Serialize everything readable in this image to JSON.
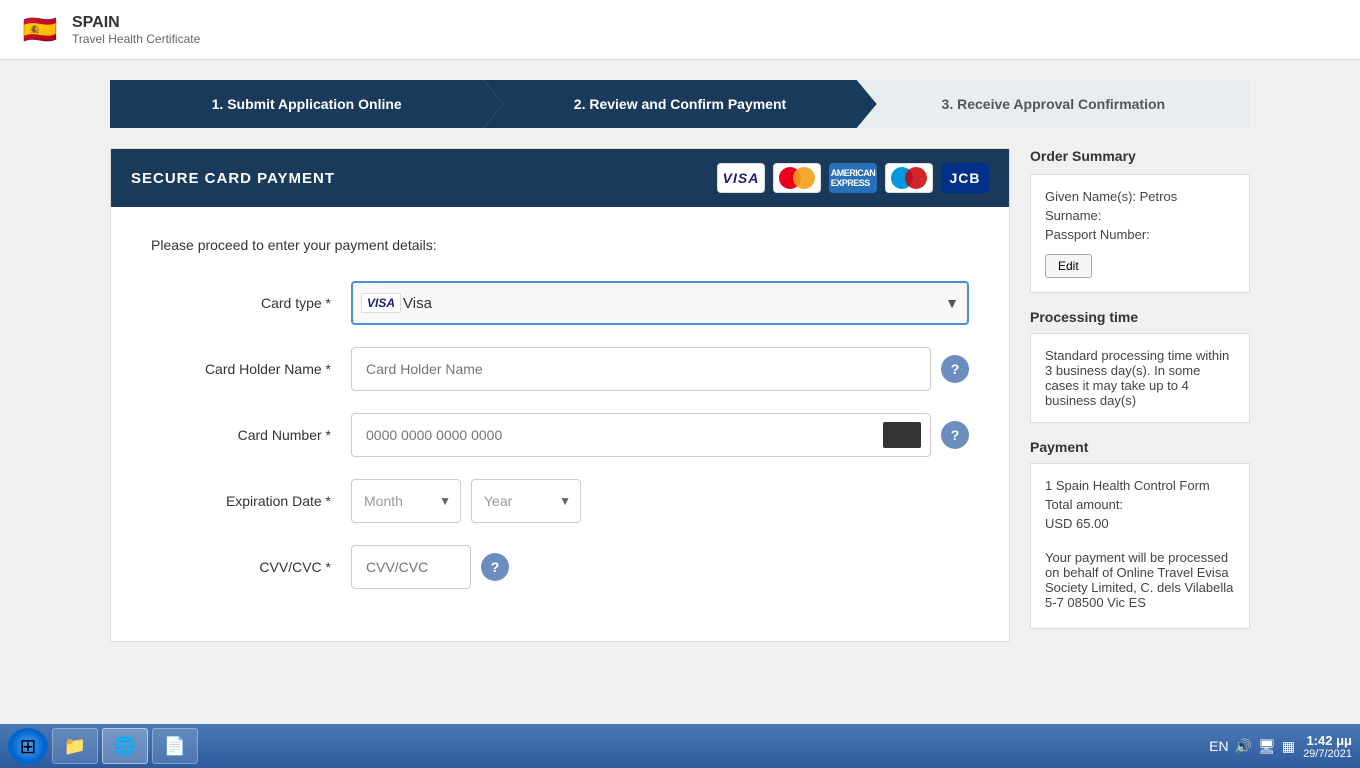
{
  "header": {
    "country": "SPAIN",
    "subtitle": "Travel Health Certificate",
    "flag_emoji": "🇪🇸"
  },
  "steps": {
    "step1": {
      "label": "1. Submit Application Online",
      "active": false
    },
    "step2": {
      "label": "2. Review and Confirm Payment",
      "active": true
    },
    "step3": {
      "label": "3. Receive Approval Confirmation",
      "active": false
    }
  },
  "payment_section": {
    "title": "SECURE CARD PAYMENT",
    "proceed_text": "Please proceed to enter your payment details:",
    "form": {
      "card_type_label": "Card type *",
      "card_type_value": "Visa",
      "card_holder_label": "Card Holder Name *",
      "card_holder_placeholder": "Card Holder Name",
      "card_number_label": "Card Number *",
      "card_number_placeholder": "0000 0000 0000 0000",
      "expiration_label": "Expiration Date *",
      "month_placeholder": "Month",
      "year_placeholder": "Year",
      "cvv_label": "CVV/CVC *",
      "cvv_placeholder": "CVV/CVC"
    }
  },
  "order_summary": {
    "title": "Order Summary",
    "given_names_label": "Given Name(s): Petros",
    "surname_label": "Surname:",
    "passport_label": "Passport Number:",
    "edit_button": "Edit",
    "processing_title": "Processing time",
    "processing_text": "Standard processing time within 3 business day(s). In some cases it may take up to 4 business day(s)",
    "payment_title": "Payment",
    "payment_item": "1 Spain Health Control Form",
    "total_label": "Total amount:",
    "total_value": "USD 65.00",
    "payment_note": "Your payment will be processed on behalf of Online Travel Evisa Society Limited, C. dels Vilabella 5-7 08500 Vic ES"
  },
  "taskbar": {
    "start_icon": "⊞",
    "buttons": [
      {
        "label": "Files",
        "icon": "📁"
      },
      {
        "label": "Chrome",
        "icon": "🌐"
      },
      {
        "label": "PDF",
        "icon": "📄"
      }
    ],
    "system": {
      "lang": "EN",
      "time": "1:42 μμ",
      "date": "29/7/2021"
    }
  }
}
